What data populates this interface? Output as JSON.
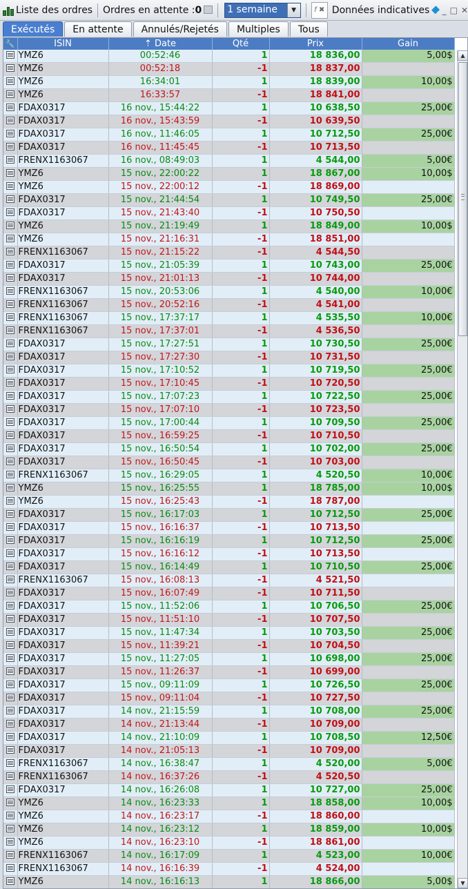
{
  "titlebar": {
    "title": "Liste des ordres",
    "pending_label": "Ordres en attente :",
    "pending_count": "0",
    "period_select": "1 semaine",
    "indicative": "Données indicatives",
    "fx_label": "f",
    "icons": [
      "candlestick-icon",
      "list-icon",
      "function-icon",
      "diamond-icon",
      "minimize-icon",
      "maximize-icon",
      "close-icon"
    ]
  },
  "tabs": [
    "Exécutés",
    "En attente",
    "Annulés/Rejetés",
    "Multiples",
    "Tous"
  ],
  "table": {
    "columns": [
      "",
      "ISIN",
      "Date",
      "Qté",
      "Prix",
      "Gain"
    ],
    "sort_indicator": "⇡",
    "rows": [
      [
        "YMZ6",
        "00:52:46",
        "1",
        "18 836,00",
        "5,00$"
      ],
      [
        "YMZ6",
        "00:52:18",
        "-1",
        "18 837,00",
        ""
      ],
      [
        "YMZ6",
        "16:34:01",
        "1",
        "18 839,00",
        "10,00$"
      ],
      [
        "YMZ6",
        "16:33:57",
        "-1",
        "18 841,00",
        ""
      ],
      [
        "FDAX0317",
        "16 nov., 15:44:22",
        "1",
        "10 638,50",
        "25,00€"
      ],
      [
        "FDAX0317",
        "16 nov., 15:43:59",
        "-1",
        "10 639,50",
        ""
      ],
      [
        "FDAX0317",
        "16 nov., 11:46:05",
        "1",
        "10 712,50",
        "25,00€"
      ],
      [
        "FDAX0317",
        "16 nov., 11:45:45",
        "-1",
        "10 713,50",
        ""
      ],
      [
        "FRENX1163067",
        "16 nov., 08:49:03",
        "1",
        "4 544,00",
        "5,00€"
      ],
      [
        "YMZ6",
        "15 nov., 22:00:22",
        "1",
        "18 867,00",
        "10,00$"
      ],
      [
        "YMZ6",
        "15 nov., 22:00:12",
        "-1",
        "18 869,00",
        ""
      ],
      [
        "FDAX0317",
        "15 nov., 21:44:54",
        "1",
        "10 749,50",
        "25,00€"
      ],
      [
        "FDAX0317",
        "15 nov., 21:43:40",
        "-1",
        "10 750,50",
        ""
      ],
      [
        "YMZ6",
        "15 nov., 21:19:49",
        "1",
        "18 849,00",
        "10,00$"
      ],
      [
        "YMZ6",
        "15 nov., 21:16:31",
        "-1",
        "18 851,00",
        ""
      ],
      [
        "FRENX1163067",
        "15 nov., 21:15:22",
        "-1",
        "4 544,50",
        ""
      ],
      [
        "FDAX0317",
        "15 nov., 21:05:39",
        "1",
        "10 743,00",
        "25,00€"
      ],
      [
        "FDAX0317",
        "15 nov., 21:01:13",
        "-1",
        "10 744,00",
        ""
      ],
      [
        "FRENX1163067",
        "15 nov., 20:53:06",
        "1",
        "4 540,00",
        "10,00€"
      ],
      [
        "FRENX1163067",
        "15 nov., 20:52:16",
        "-1",
        "4 541,00",
        ""
      ],
      [
        "FRENX1163067",
        "15 nov., 17:37:17",
        "1",
        "4 535,50",
        "10,00€"
      ],
      [
        "FRENX1163067",
        "15 nov., 17:37:01",
        "-1",
        "4 536,50",
        ""
      ],
      [
        "FDAX0317",
        "15 nov., 17:27:51",
        "1",
        "10 730,50",
        "25,00€"
      ],
      [
        "FDAX0317",
        "15 nov., 17:27:30",
        "-1",
        "10 731,50",
        ""
      ],
      [
        "FDAX0317",
        "15 nov., 17:10:52",
        "1",
        "10 719,50",
        "25,00€"
      ],
      [
        "FDAX0317",
        "15 nov., 17:10:45",
        "-1",
        "10 720,50",
        ""
      ],
      [
        "FDAX0317",
        "15 nov., 17:07:23",
        "1",
        "10 722,50",
        "25,00€"
      ],
      [
        "FDAX0317",
        "15 nov., 17:07:10",
        "-1",
        "10 723,50",
        ""
      ],
      [
        "FDAX0317",
        "15 nov., 17:00:44",
        "1",
        "10 709,50",
        "25,00€"
      ],
      [
        "FDAX0317",
        "15 nov., 16:59:25",
        "-1",
        "10 710,50",
        ""
      ],
      [
        "FDAX0317",
        "15 nov., 16:50:54",
        "1",
        "10 702,00",
        "25,00€"
      ],
      [
        "FDAX0317",
        "15 nov., 16:50:45",
        "-1",
        "10 703,00",
        ""
      ],
      [
        "FRENX1163067",
        "15 nov., 16:29:05",
        "1",
        "4 520,50",
        "10,00€"
      ],
      [
        "YMZ6",
        "15 nov., 16:25:55",
        "1",
        "18 785,00",
        "10,00$"
      ],
      [
        "YMZ6",
        "15 nov., 16:25:43",
        "-1",
        "18 787,00",
        ""
      ],
      [
        "FDAX0317",
        "15 nov., 16:17:03",
        "1",
        "10 712,50",
        "25,00€"
      ],
      [
        "FDAX0317",
        "15 nov., 16:16:37",
        "-1",
        "10 713,50",
        ""
      ],
      [
        "FDAX0317",
        "15 nov., 16:16:19",
        "1",
        "10 712,50",
        "25,00€"
      ],
      [
        "FDAX0317",
        "15 nov., 16:16:12",
        "-1",
        "10 713,50",
        ""
      ],
      [
        "FDAX0317",
        "15 nov., 16:14:49",
        "1",
        "10 710,50",
        "25,00€"
      ],
      [
        "FRENX1163067",
        "15 nov., 16:08:13",
        "-1",
        "4 521,50",
        ""
      ],
      [
        "FDAX0317",
        "15 nov., 16:07:49",
        "-1",
        "10 711,50",
        ""
      ],
      [
        "FDAX0317",
        "15 nov., 11:52:06",
        "1",
        "10 706,50",
        "25,00€"
      ],
      [
        "FDAX0317",
        "15 nov., 11:51:10",
        "-1",
        "10 707,50",
        ""
      ],
      [
        "FDAX0317",
        "15 nov., 11:47:34",
        "1",
        "10 703,50",
        "25,00€"
      ],
      [
        "FDAX0317",
        "15 nov., 11:39:21",
        "-1",
        "10 704,50",
        ""
      ],
      [
        "FDAX0317",
        "15 nov., 11:27:05",
        "1",
        "10 698,00",
        "25,00€"
      ],
      [
        "FDAX0317",
        "15 nov., 11:26:37",
        "-1",
        "10 699,00",
        ""
      ],
      [
        "FDAX0317",
        "15 nov., 09:11:09",
        "1",
        "10 726,50",
        "25,00€"
      ],
      [
        "FDAX0317",
        "15 nov., 09:11:04",
        "-1",
        "10 727,50",
        ""
      ],
      [
        "FDAX0317",
        "14 nov., 21:15:59",
        "1",
        "10 708,00",
        "25,00€"
      ],
      [
        "FDAX0317",
        "14 nov., 21:13:44",
        "-1",
        "10 709,00",
        ""
      ],
      [
        "FDAX0317",
        "14 nov., 21:10:09",
        "1",
        "10 708,50",
        "12,50€"
      ],
      [
        "FDAX0317",
        "14 nov., 21:05:13",
        "-1",
        "10 709,00",
        ""
      ],
      [
        "FRENX1163067",
        "14 nov., 16:38:47",
        "1",
        "4 520,00",
        "5,00€"
      ],
      [
        "FRENX1163067",
        "14 nov., 16:37:26",
        "-1",
        "4 520,50",
        ""
      ],
      [
        "FDAX0317",
        "14 nov., 16:26:08",
        "1",
        "10 727,00",
        "25,00€"
      ],
      [
        "YMZ6",
        "14 nov., 16:23:33",
        "1",
        "18 858,00",
        "10,00$"
      ],
      [
        "YMZ6",
        "14 nov., 16:23:17",
        "-1",
        "18 860,00",
        ""
      ],
      [
        "YMZ6",
        "14 nov., 16:23:12",
        "1",
        "18 859,00",
        "10,00$"
      ],
      [
        "YMZ6",
        "14 nov., 16:23:10",
        "-1",
        "18 861,00",
        ""
      ],
      [
        "FRENX1163067",
        "14 nov., 16:17:09",
        "1",
        "4 523,00",
        "10,00€"
      ],
      [
        "FRENX1163067",
        "14 nov., 16:16:39",
        "-1",
        "4 524,00",
        ""
      ],
      [
        "YMZ6",
        "14 nov., 16:16:13",
        "1",
        "18 866,00",
        "5,00$"
      ]
    ]
  },
  "colors": {
    "positive": "#0a9a0e",
    "negative": "#c01018",
    "gain_bg": "#a8d3a0",
    "header_bg": "#4c7cc4",
    "active_tab": "#4a7fd0"
  }
}
